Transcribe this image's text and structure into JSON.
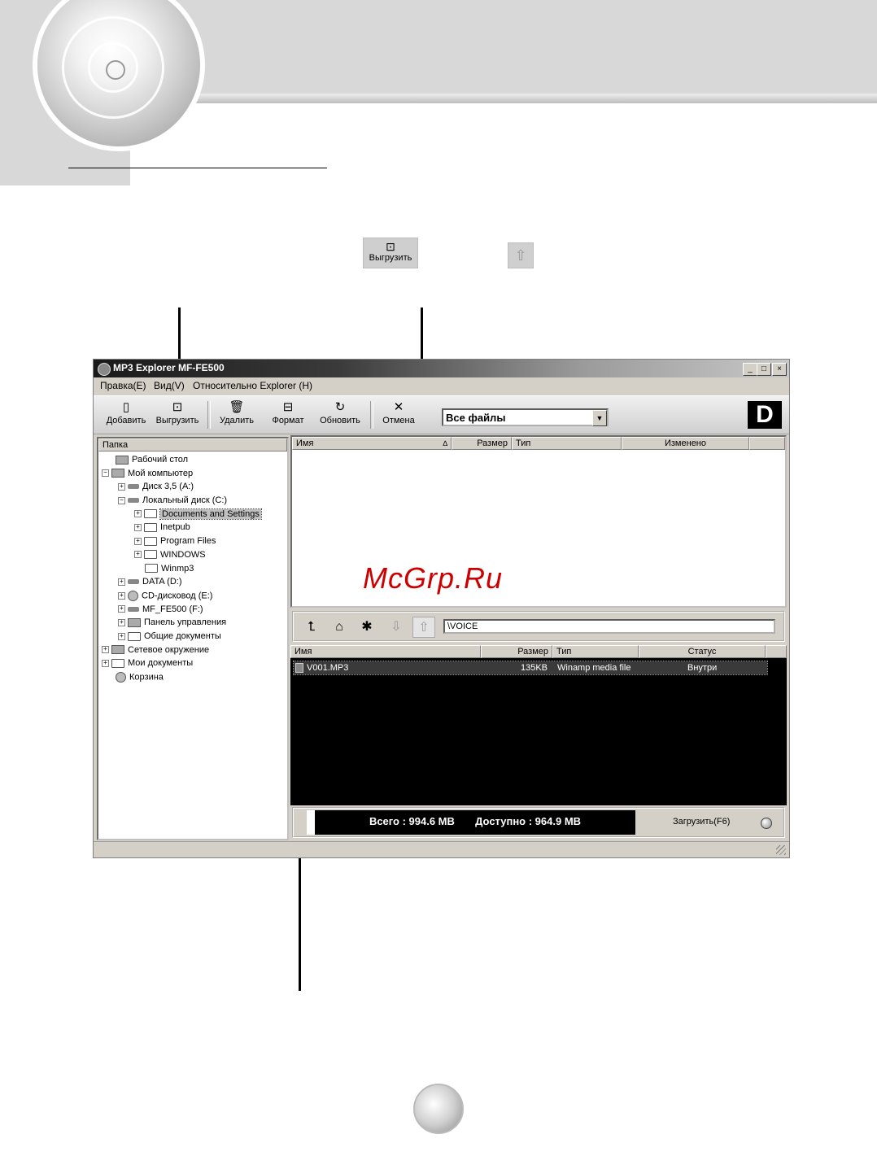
{
  "toolbar_preview": {
    "upload_label": "Выгрузить"
  },
  "window": {
    "title": "MP3 Explorer  MF-FE500",
    "controls": {
      "minimize": "_",
      "maximize": "□",
      "close": "×"
    }
  },
  "menu": [
    "Правка(E)",
    "Вид(V)",
    "Относительно Explorer (H)"
  ],
  "toolbar": {
    "add": "Добавить",
    "upload": "Выгрузить",
    "delete": "Удалить",
    "format": "Формат",
    "refresh": "Обновить",
    "cancel": "Отмена",
    "filter_value": "Все файлы",
    "logo": "D"
  },
  "tree": {
    "header": "Папка",
    "items": [
      {
        "label": "Рабочий стол",
        "icon": "desktop-icon"
      },
      {
        "label": "Мой компьютер",
        "icon": "computer-icon"
      },
      {
        "label": "Диск 3,5 (A:)",
        "icon": "floppy-icon"
      },
      {
        "label": "Локальный диск (C:)",
        "icon": "drive-icon"
      },
      {
        "label": "Documents and Settings",
        "icon": "folder-icon"
      },
      {
        "label": "Inetpub",
        "icon": "folder-icon"
      },
      {
        "label": "Program Files",
        "icon": "folder-icon"
      },
      {
        "label": "WINDOWS",
        "icon": "folder-icon"
      },
      {
        "label": "Winmp3",
        "icon": "folder-icon"
      },
      {
        "label": "DATA (D:)",
        "icon": "drive-icon"
      },
      {
        "label": "CD-дисковод (E:)",
        "icon": "cd-icon"
      },
      {
        "label": "MF_FE500 (F:)",
        "icon": "drive-icon"
      },
      {
        "label": "Панель управления",
        "icon": "control-panel-icon"
      },
      {
        "label": "Общие документы",
        "icon": "folder-icon"
      },
      {
        "label": "Сетевое окружение",
        "icon": "network-icon"
      },
      {
        "label": "Мои документы",
        "icon": "documents-icon"
      },
      {
        "label": "Корзина",
        "icon": "recycle-bin-icon"
      }
    ]
  },
  "pc_list": {
    "columns": [
      "Имя",
      "Размер",
      "Тип",
      "Изменено"
    ],
    "sort_glyph": "∆"
  },
  "device": {
    "path": "\\VOICE",
    "columns": [
      "Имя",
      "Размер",
      "Тип",
      "Статус"
    ],
    "rows": [
      {
        "name": "V001.MP3",
        "size": "135KB",
        "type": "Winamp media file",
        "status": "Внутри"
      }
    ]
  },
  "status": {
    "total_label": "Всего : 994.6 MB",
    "free_label": "Доступно : 964.9 MB",
    "load_button": "Загрузить(F6)"
  },
  "watermark": "McGrp.Ru"
}
